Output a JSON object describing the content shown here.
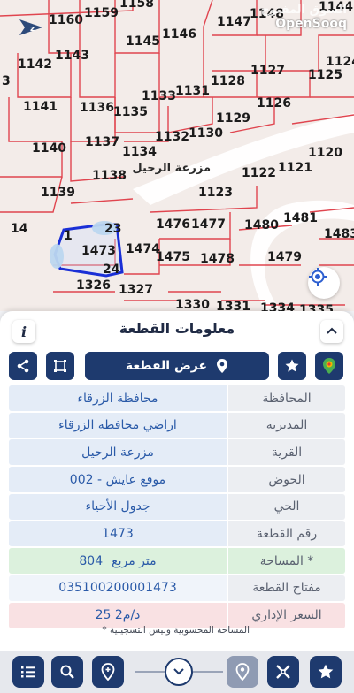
{
  "map": {
    "watermark_arabic": "السوق المفتوح",
    "watermark_latin": "OpenSooq",
    "area_name": "مزرعة الرحيل",
    "side_mark": "3",
    "parcels": [
      "1160",
      "1159",
      "1158",
      "1147",
      "1148",
      "1144",
      "1146",
      "1145",
      "1142",
      "1143",
      "1127",
      "1125",
      "1124",
      "1128",
      "1141",
      "1133",
      "1131",
      "1136",
      "1135",
      "1126",
      "1129",
      "1137",
      "1132",
      "1130",
      "1140",
      "1134",
      "1120",
      "1138",
      "1122",
      "1121",
      "1139",
      "1123",
      "14",
      "1481",
      "1483",
      "1476",
      "1477",
      "1480",
      "1473",
      "1474",
      "1475",
      "1478",
      "1479",
      "1326",
      "1327",
      "1330",
      "1331",
      "1334",
      "1335",
      "23",
      "24",
      "1"
    ]
  },
  "sheet": {
    "title": "معلومات القطعة",
    "info_label": "i",
    "show_parcel_label": "عرض القطعة",
    "rows": [
      {
        "key": "المحافظة",
        "value": "محافظة الزرقاء"
      },
      {
        "key": "المديرية",
        "value": "اراضي محافظة الزرقاء"
      },
      {
        "key": "القرية",
        "value": "مزرعة الرحيل"
      },
      {
        "key": "الحوض",
        "value": "موقع عايش - 002"
      },
      {
        "key": "الحي",
        "value": "جدول الأحياء"
      },
      {
        "key": "رقم القطعة",
        "value": "1473"
      },
      {
        "key": "المساحة *",
        "value_number": "804",
        "value_unit": "متر مربع"
      },
      {
        "key": "مفتاح القطعة",
        "value": "035100200001473"
      },
      {
        "key": "السعر الإداري",
        "value": "25 د/م2"
      }
    ],
    "footnote": "* المساحة المحسوبية وليس التسجيلية"
  },
  "colors": {
    "primary": "#1e3a6e",
    "value_text": "#2a5aa8",
    "highlight_parcel": "#1a2fd6",
    "boundary_red": "#e0454f"
  },
  "icons": [
    "compass-icon",
    "locate-icon",
    "info-icon",
    "chevron-down-icon",
    "layers-icon",
    "star-icon",
    "pin-icon",
    "frame-icon",
    "share-icon",
    "list-icon",
    "search-icon",
    "location-add-icon",
    "map-pin-icon",
    "ruler-icon"
  ]
}
